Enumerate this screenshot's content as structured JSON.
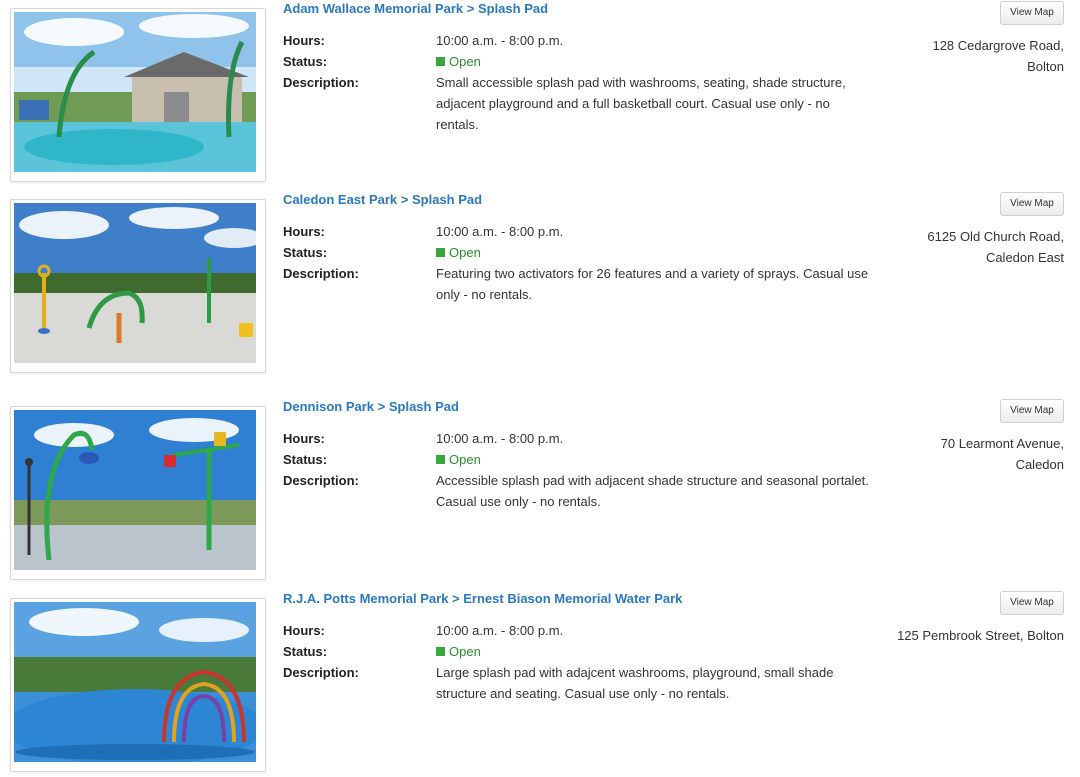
{
  "labels": {
    "hours": "Hours:",
    "status": "Status:",
    "description": "Description:",
    "view_map": "View Map"
  },
  "parks": [
    {
      "title": "Adam Wallace Memorial Park > Splash Pad",
      "hours": "10:00 a.m. - 8:00 p.m.",
      "status": "Open",
      "description": "Small accessible splash pad with washrooms, seating, shade structure, adjacent playground and a full basketball court. Casual use only - no rentals.",
      "address_line1": "128 Cedargrove Road,",
      "address_line2": "Bolton"
    },
    {
      "title": "Caledon East Park > Splash Pad",
      "hours": "10:00 a.m. - 8:00 p.m.",
      "status": "Open",
      "description": "Featuring two activators for 26 features and a variety of sprays. Casual use only - no rentals.",
      "address_line1": "6125 Old Church Road,",
      "address_line2": "Caledon East"
    },
    {
      "title": "Dennison Park > Splash Pad",
      "hours": "10:00 a.m. - 8:00 p.m.",
      "status": "Open",
      "description": "Accessible splash pad with adjacent shade structure and seasonal portalet.   Casual use only - no rentals.",
      "address_line1": "70 Learmont Avenue,",
      "address_line2": "Caledon"
    },
    {
      "title": "R.J.A. Potts Memorial Park > Ernest Biason Memorial Water Park",
      "hours": "10:00 a.m. - 8:00 p.m.",
      "status": "Open",
      "description": "Large splash pad with adajcent washrooms, playground, small shade structure and seating. Casual use only - no rentals.",
      "address_line1": "125 Pembrook Street, Bolton",
      "address_line2": ""
    }
  ],
  "colors": {
    "link": "#2b78bd",
    "status_open": "#3aa63a"
  }
}
